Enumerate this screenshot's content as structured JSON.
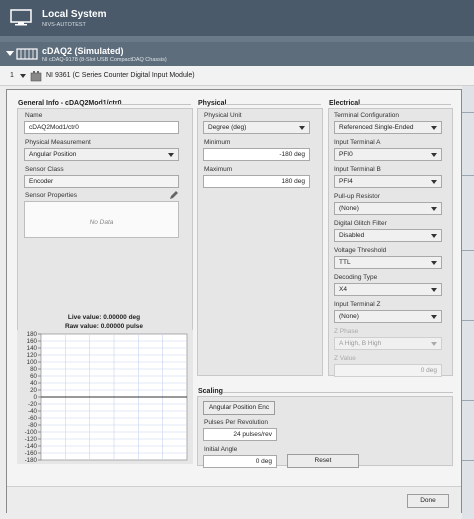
{
  "system": {
    "title": "Local System",
    "subtitle": "NIVS-AUTOTEST"
  },
  "chassis": {
    "title": "cDAQ2 (Simulated)",
    "subtitle": "NI cDAQ-9178 (8-Slot USB CompactDAQ Chassis)"
  },
  "module": {
    "number": "1",
    "title": "NI 9361 (C Series Counter Digital Input Module)"
  },
  "general": {
    "section_title": "General Info - cDAQ2Mod1/ctr0",
    "name_label": "Name",
    "name_value": "cDAQ2Mod1/ctr0",
    "measurement_label": "Physical Measurement",
    "measurement_value": "Angular Position",
    "sensor_class_label": "Sensor Class",
    "sensor_class_value": "Encoder",
    "sensor_props_label": "Sensor Properties",
    "no_data": "No Data",
    "live_value": "Live value: 0.00000 deg",
    "raw_value": "Raw value: 0.00000 pulse"
  },
  "physical": {
    "section_title": "Physical",
    "unit_label": "Physical Unit",
    "unit_value": "Degree (deg)",
    "min_label": "Minimum",
    "min_value": "-180 deg",
    "max_label": "Maximum",
    "max_value": "180 deg"
  },
  "electrical": {
    "section_title": "Electrical",
    "terminal_config_label": "Terminal Configuration",
    "terminal_config_value": "Referenced Single-Ended",
    "input_a_label": "Input Terminal A",
    "input_a_value": "PFI0",
    "input_b_label": "Input Terminal B",
    "input_b_value": "PFI4",
    "pullup_label": "Pull-up Resistor",
    "pullup_value": "(None)",
    "glitch_label": "Digital Glitch Filter",
    "glitch_value": "Disabled",
    "voltage_label": "Voltage Threshold",
    "voltage_value": "TTL",
    "decoding_label": "Decoding Type",
    "decoding_value": "X4",
    "input_z_label": "Input Terminal Z",
    "input_z_value": "(None)",
    "z_phase_label": "Z Phase",
    "z_phase_value": "A High, B High",
    "z_value_label": "Z Value",
    "z_value_value": "0 deg"
  },
  "scaling": {
    "section_title": "Scaling",
    "scale_button": "Angular Position Enc",
    "ppr_label": "Pulses Per Revolution",
    "ppr_value": "24 pulses/rev",
    "initial_angle_label": "Initial Angle",
    "initial_angle_value": "0 deg",
    "reset_button": "Reset"
  },
  "footer": {
    "done_button": "Done"
  },
  "colors": {
    "header_dark": "#4a5a6a",
    "chassis_bar": "#5d6d7c",
    "plot_line": "#333333",
    "grid": "#c9d4f0"
  },
  "chart_data": {
    "type": "line",
    "title": "",
    "xlabel": "",
    "ylabel": "",
    "ylim": [
      -180,
      180
    ],
    "y_ticks": [
      180,
      160,
      140,
      120,
      100,
      80,
      60,
      40,
      20,
      0,
      -20,
      -40,
      -60,
      -80,
      -100,
      -120,
      -140,
      -160,
      -180
    ],
    "y_tick_labels": [
      "180",
      "160",
      "140",
      "120",
      "100",
      "80",
      "60",
      "40",
      "20",
      "0",
      "-20",
      "-40",
      "-60",
      "-80",
      "-100",
      "-120",
      "-140",
      "-160",
      "-180"
    ],
    "grid": true,
    "series": [
      {
        "values": [
          0,
          0
        ]
      }
    ]
  }
}
